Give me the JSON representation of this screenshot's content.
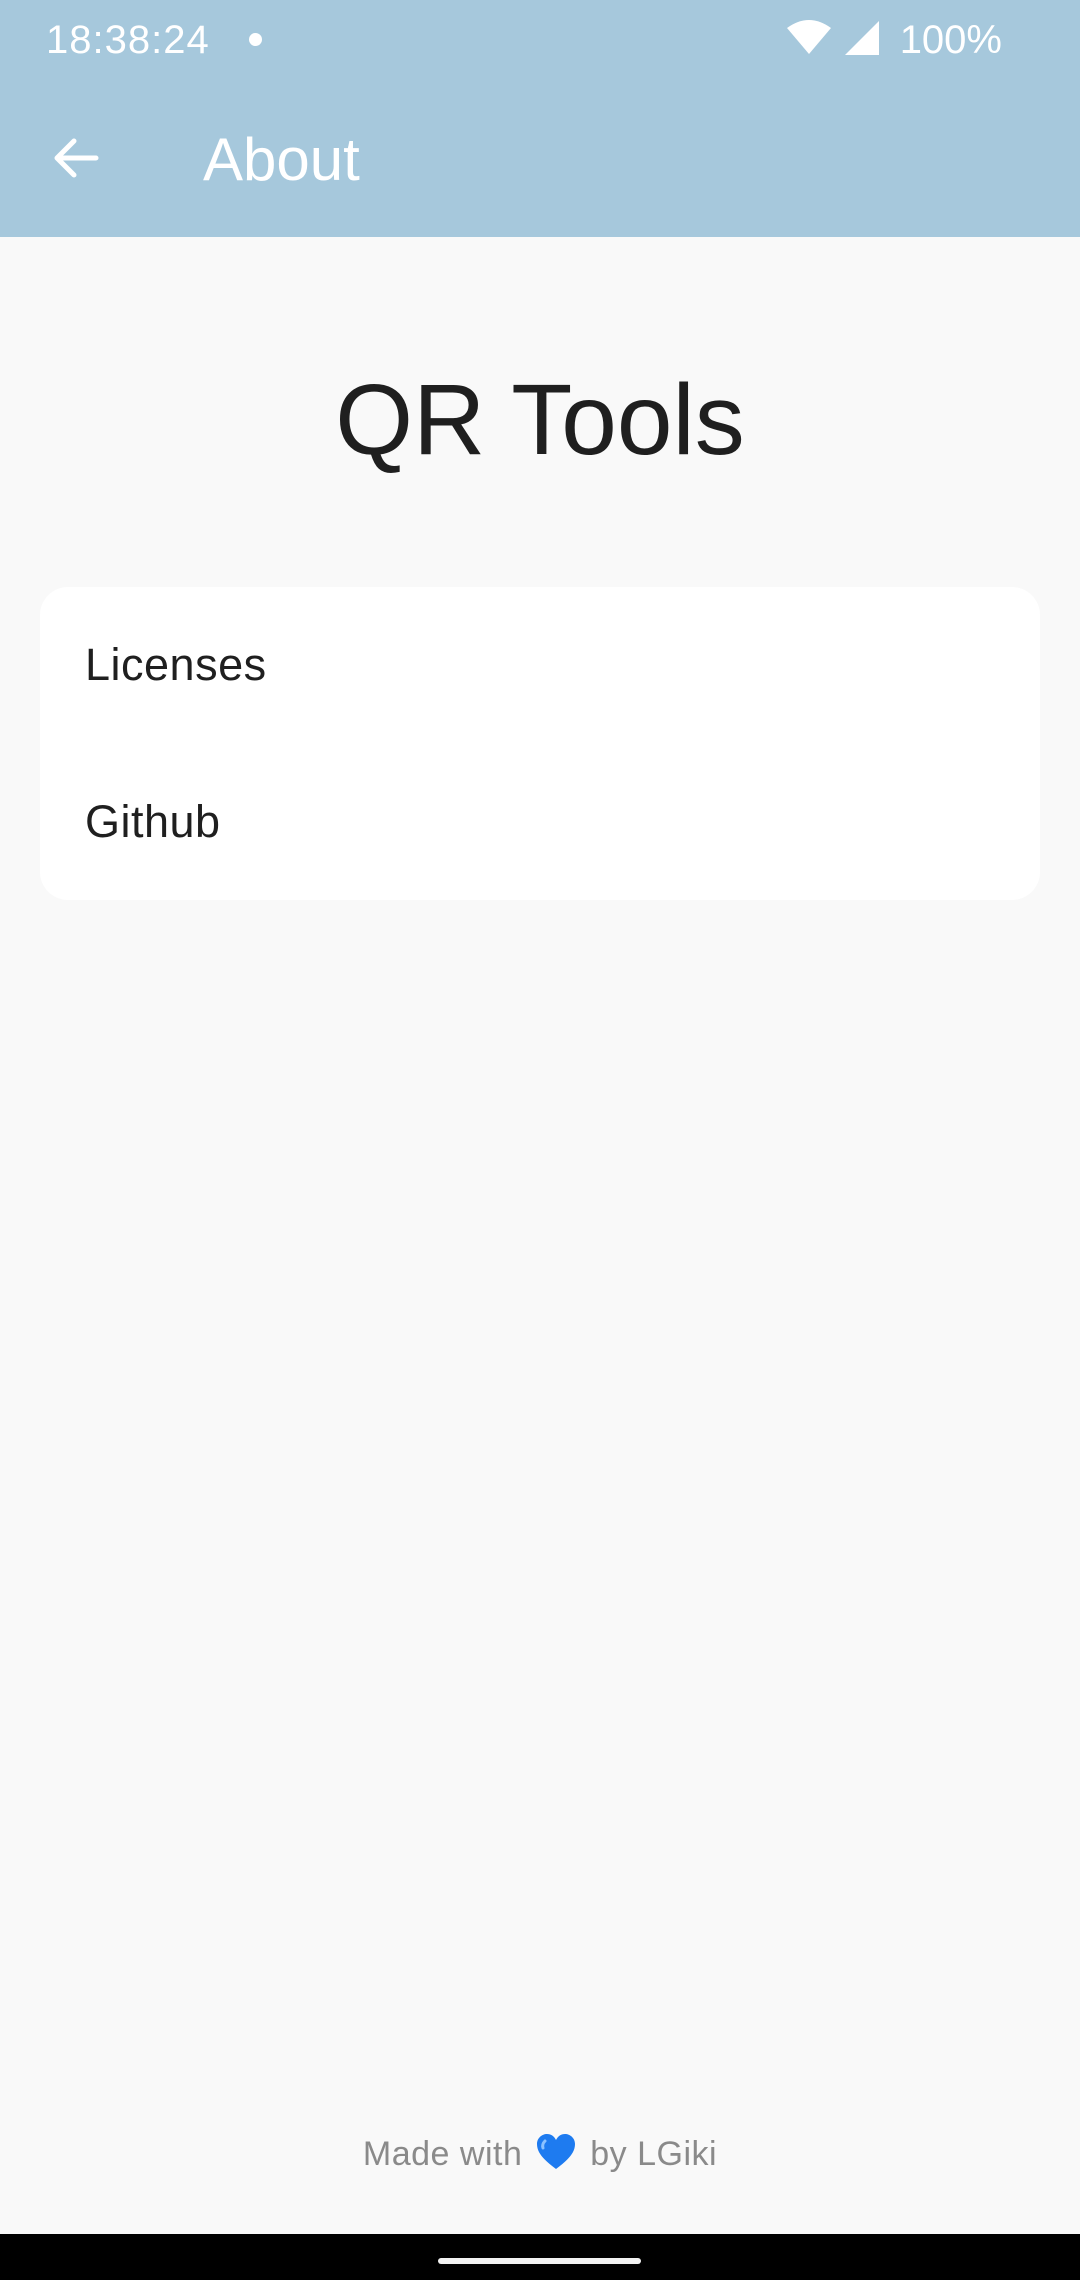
{
  "status_bar": {
    "time": "18:38:24",
    "battery": "100%",
    "icons": [
      "wifi-icon",
      "cell-signal-icon"
    ]
  },
  "app_bar": {
    "title": "About",
    "back_icon": "arrow-back-icon"
  },
  "app_name": "QR Tools",
  "menu": {
    "items": [
      {
        "label": "Licenses"
      },
      {
        "label": "Github"
      }
    ]
  },
  "footer": {
    "prefix": "Made with",
    "icon": "blue-heart-icon",
    "suffix": "by LGiki"
  },
  "colors": {
    "app_bar": "#a6c8dc",
    "background": "#f9f9f9",
    "card": "#ffffff",
    "heart": "#1e7bf0"
  }
}
